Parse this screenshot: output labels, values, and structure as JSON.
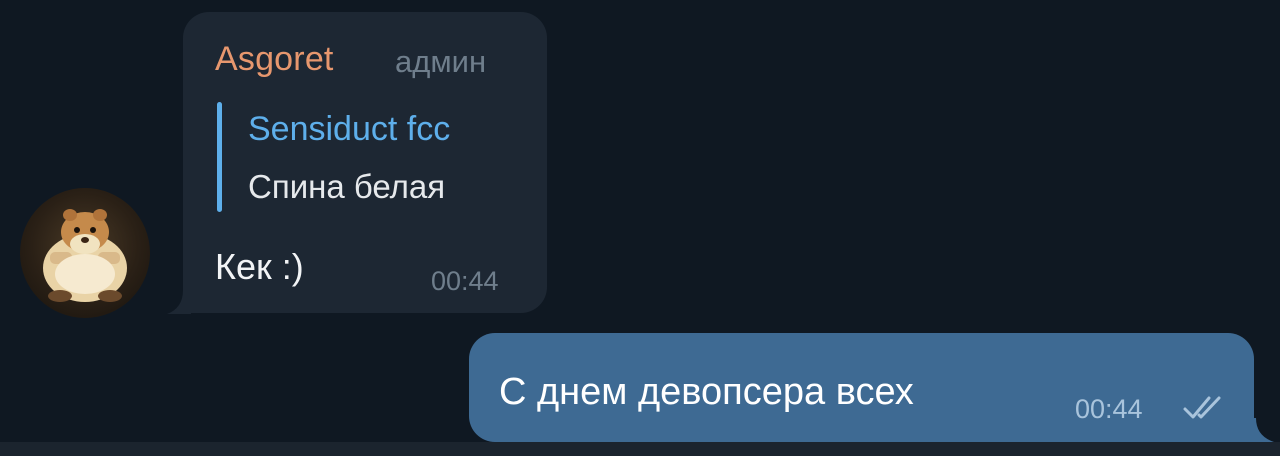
{
  "incoming_message": {
    "sender_name": "Asgoret",
    "sender_role": "админ",
    "reply": {
      "author": "Sensiduct fcc",
      "text": "Спина белая"
    },
    "text": "Кек :)",
    "time": "00:44",
    "avatar_icon": "hamster-avatar-icon"
  },
  "outgoing_message": {
    "text": "С днем девопсера всех",
    "time": "00:44",
    "status_icon": "double-check-icon"
  },
  "colors": {
    "background": "#0f1822",
    "incoming_bubble": "#1d2733",
    "outgoing_bubble": "#3e6a93",
    "sender_name": "#e7976e",
    "reply_accent": "#5eafeb",
    "muted_text": "#6f7e8c"
  }
}
